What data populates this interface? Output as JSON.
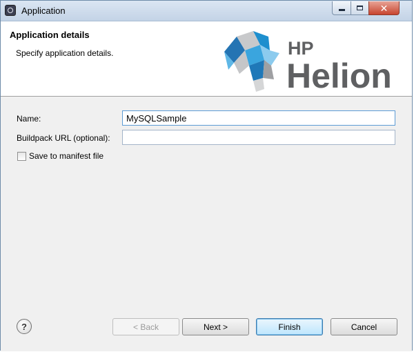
{
  "window": {
    "title": "Application",
    "close_glyph": "✕"
  },
  "header": {
    "title": "Application details",
    "description": "Specify application details.",
    "logo": {
      "hp": "HP",
      "product": "Helion"
    }
  },
  "form": {
    "name_label": "Name:",
    "name_value": "MySQLSample",
    "buildpack_label": "Buildpack URL (optional):",
    "buildpack_value": "",
    "manifest_label": "Save to manifest file",
    "manifest_checked": false
  },
  "footer": {
    "help_glyph": "?",
    "back_label": "< Back",
    "next_label": "Next >",
    "finish_label": "Finish",
    "cancel_label": "Cancel"
  },
  "icons": [
    "app-icon",
    "minimize-icon",
    "maximize-icon",
    "close-icon",
    "help-icon",
    "hp-helion-logo"
  ],
  "colors": {
    "logo_blue": "#1e8fce",
    "logo_grey": "#5f6062",
    "focus_border": "#5b9bd5"
  }
}
